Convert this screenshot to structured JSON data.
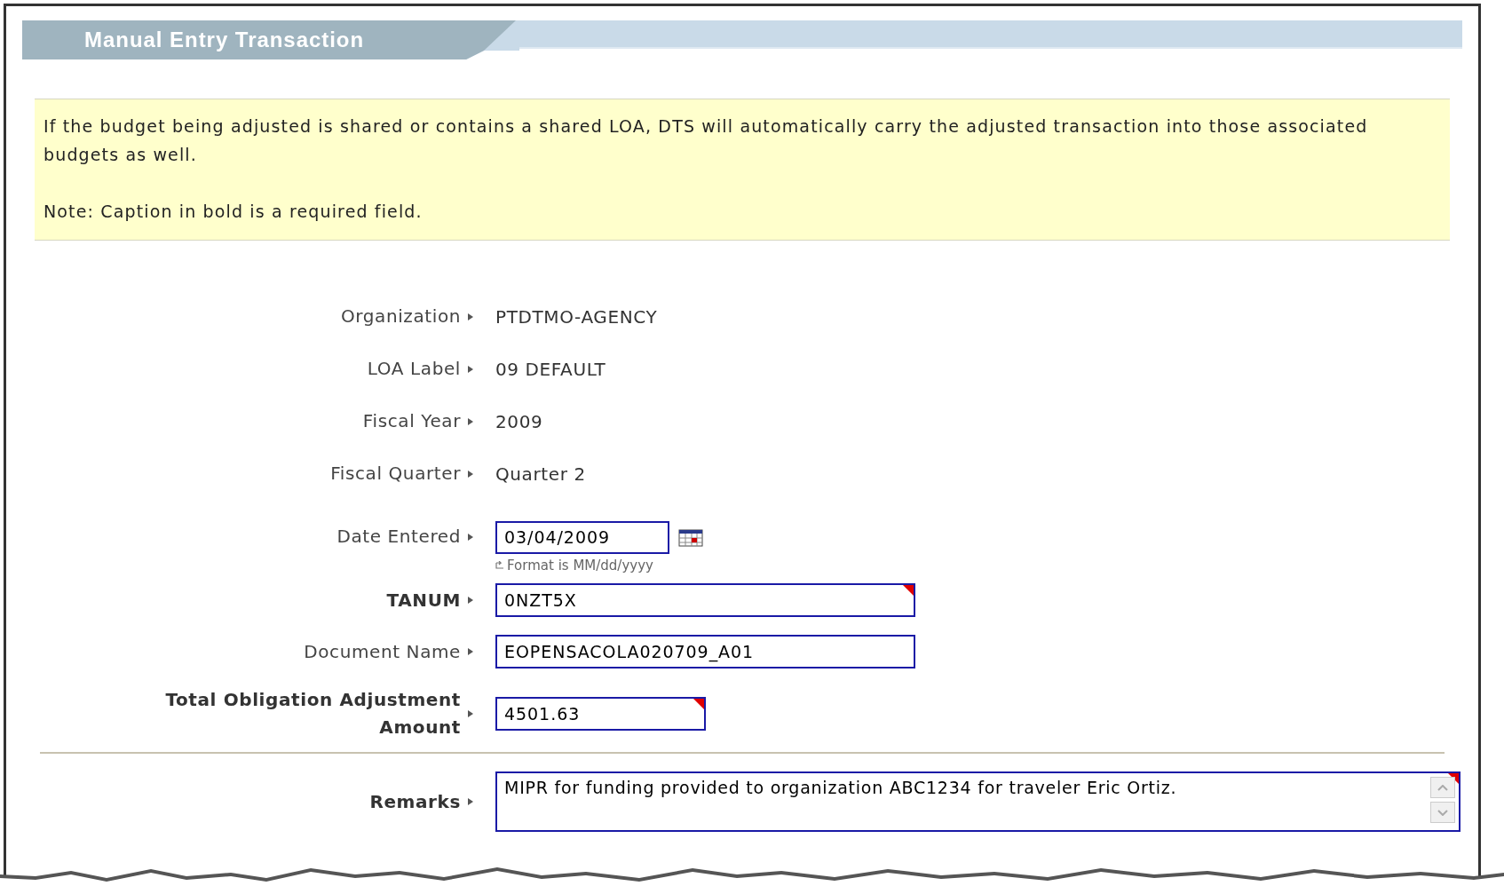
{
  "panel": {
    "title": "Manual Entry Transaction"
  },
  "notice": {
    "message": "If the budget being adjusted is shared or contains a shared LOA, DTS will automatically carry the adjusted transaction into those associated budgets as well.",
    "note": "Note: Caption in bold is a required field."
  },
  "fields": [
    {
      "kind": "text",
      "label": "Organization",
      "required": false,
      "value": "PTDTMO-AGENCY"
    },
    {
      "kind": "text",
      "label": "LOA Label",
      "required": false,
      "value": "09 DEFAULT"
    },
    {
      "kind": "text",
      "label": "Fiscal Year",
      "required": false,
      "value": "2009"
    },
    {
      "kind": "text",
      "label": "Fiscal Quarter",
      "required": false,
      "value": "Quarter 2"
    },
    {
      "kind": "date",
      "label": "Date Entered",
      "required": false,
      "value": "03/04/2009",
      "hint": "Format is MM/dd/yyyy"
    },
    {
      "kind": "input",
      "label": "TANUM",
      "required": true,
      "value": "0NZT5X"
    },
    {
      "kind": "input",
      "label": "Document Name",
      "required": false,
      "value": "EOPENSACOLA020709_A01"
    },
    {
      "kind": "amount",
      "label": "Total Obligation Adjustment Amount",
      "required": true,
      "value": "4501.63"
    },
    {
      "kind": "textarea",
      "label": "Remarks",
      "required": true,
      "value": "MIPR for funding provided to organization ABC1234 for traveler Eric Ortiz."
    }
  ]
}
